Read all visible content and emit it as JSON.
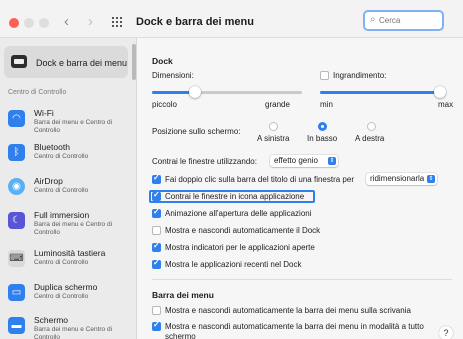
{
  "window": {
    "title": "Dock e barra dei menu",
    "search_placeholder": "Cerca",
    "icons": [
      "close-light",
      "minimize-light",
      "zoom-light",
      "chevron-left-icon",
      "chevron-right-icon",
      "grid-icon",
      "search-icon"
    ]
  },
  "sidebar": {
    "selected": {
      "label": "Dock e barra dei menu",
      "icon": "dock-icon"
    },
    "section_label": "Centro di Controllo",
    "items": [
      {
        "title": "Wi-Fi",
        "subtitle": "Barra dei menu e Centro di Controllo",
        "icon": "wifi-icon",
        "color": "#2f80ed"
      },
      {
        "title": "Bluetooth",
        "subtitle": "Centro di Controllo",
        "icon": "bluetooth-icon",
        "color": "#2f80ed"
      },
      {
        "title": "AirDrop",
        "subtitle": "Centro di Controllo",
        "icon": "airdrop-icon",
        "color": "#5ab0f5"
      },
      {
        "title": "Full immersion",
        "subtitle": "Barra dei menu e Centro di Controllo",
        "icon": "moon-icon",
        "color": "#5856d6"
      },
      {
        "title": "Luminosità tastiera",
        "subtitle": "Centro di Controllo",
        "icon": "keyboard-icon",
        "color": "#d9d9d9"
      },
      {
        "title": "Duplica schermo",
        "subtitle": "Centro di Controllo",
        "icon": "screen-mirror-icon",
        "color": "#2f80ed"
      },
      {
        "title": "Schermo",
        "subtitle": "Barra dei menu e Centro di Controllo",
        "icon": "display-icon",
        "color": "#2f80ed"
      }
    ]
  },
  "dock": {
    "title": "Dock",
    "size_label": "Dimensioni:",
    "size_min": "piccolo",
    "size_max": "grande",
    "size_value": 0.27,
    "magnify_label": "Ingrandimento:",
    "magnify_checked": false,
    "magnify_min": "min",
    "magnify_max": "max",
    "magnify_value": 1.0,
    "position_label": "Posizione sullo schermo:",
    "positions": [
      "A sinistra",
      "In basso",
      "A destra"
    ],
    "position_selected": "In basso",
    "minimize_label": "Contrai le finestre utilizzando:",
    "minimize_value": "effetto genio",
    "double_click_label": "Fai doppio clic sulla barra del titolo di una finestra per",
    "double_click_value": "ridimensionarla",
    "options": [
      {
        "label": "Contrai le finestre in icona applicazione",
        "checked": true
      },
      {
        "label": "Animazione all'apertura delle applicazioni",
        "checked": true
      },
      {
        "label": "Mostra e nascondi automaticamente il Dock",
        "checked": false
      },
      {
        "label": "Mostra indicatori per le applicazioni aperte",
        "checked": true
      },
      {
        "label": "Mostra le applicazioni recenti nel Dock",
        "checked": true
      }
    ]
  },
  "menubar": {
    "title": "Barra dei menu",
    "options": [
      {
        "label": "Mostra e nascondi automaticamente la barra dei menu sulla scrivania",
        "checked": false
      },
      {
        "label": "Mostra e nascondi automaticamente la barra dei menu in modalità a tutto schermo",
        "checked": true
      }
    ]
  },
  "help": "?"
}
